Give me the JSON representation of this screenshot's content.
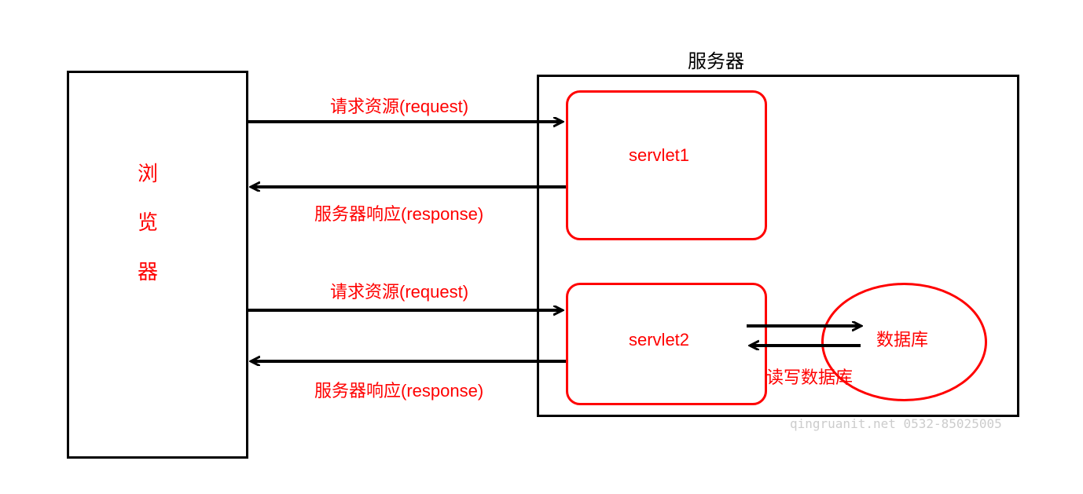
{
  "browser": {
    "label": "浏\n览\n器"
  },
  "server": {
    "title": "服务器",
    "servlet1": "servlet1",
    "servlet2": "servlet2",
    "database": "数据库",
    "db_rw_label": "读写数据库"
  },
  "arrows": {
    "request1": "请求资源(request)",
    "response1": "服务器响应(response)",
    "request2": "请求资源(request)",
    "response2": "服务器响应(response)"
  },
  "watermark": "qingruanit.net 0532-85025005"
}
